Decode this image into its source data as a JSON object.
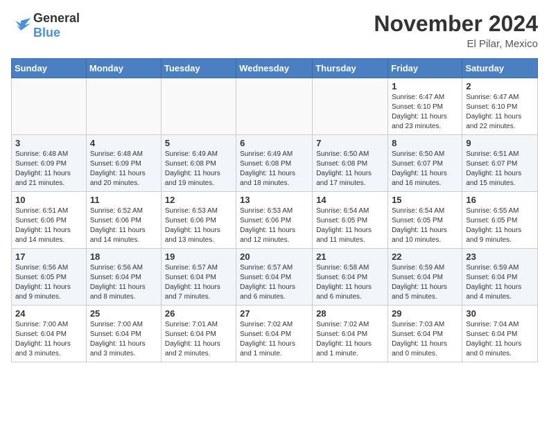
{
  "logo": {
    "general": "General",
    "blue": "Blue"
  },
  "title": "November 2024",
  "location": "El Pilar, Mexico",
  "days_of_week": [
    "Sunday",
    "Monday",
    "Tuesday",
    "Wednesday",
    "Thursday",
    "Friday",
    "Saturday"
  ],
  "weeks": [
    [
      {
        "day": "",
        "info": ""
      },
      {
        "day": "",
        "info": ""
      },
      {
        "day": "",
        "info": ""
      },
      {
        "day": "",
        "info": ""
      },
      {
        "day": "",
        "info": ""
      },
      {
        "day": "1",
        "info": "Sunrise: 6:47 AM\nSunset: 6:10 PM\nDaylight: 11 hours and 23 minutes."
      },
      {
        "day": "2",
        "info": "Sunrise: 6:47 AM\nSunset: 6:10 PM\nDaylight: 11 hours and 22 minutes."
      }
    ],
    [
      {
        "day": "3",
        "info": "Sunrise: 6:48 AM\nSunset: 6:09 PM\nDaylight: 11 hours and 21 minutes."
      },
      {
        "day": "4",
        "info": "Sunrise: 6:48 AM\nSunset: 6:09 PM\nDaylight: 11 hours and 20 minutes."
      },
      {
        "day": "5",
        "info": "Sunrise: 6:49 AM\nSunset: 6:08 PM\nDaylight: 11 hours and 19 minutes."
      },
      {
        "day": "6",
        "info": "Sunrise: 6:49 AM\nSunset: 6:08 PM\nDaylight: 11 hours and 18 minutes."
      },
      {
        "day": "7",
        "info": "Sunrise: 6:50 AM\nSunset: 6:08 PM\nDaylight: 11 hours and 17 minutes."
      },
      {
        "day": "8",
        "info": "Sunrise: 6:50 AM\nSunset: 6:07 PM\nDaylight: 11 hours and 16 minutes."
      },
      {
        "day": "9",
        "info": "Sunrise: 6:51 AM\nSunset: 6:07 PM\nDaylight: 11 hours and 15 minutes."
      }
    ],
    [
      {
        "day": "10",
        "info": "Sunrise: 6:51 AM\nSunset: 6:06 PM\nDaylight: 11 hours and 14 minutes."
      },
      {
        "day": "11",
        "info": "Sunrise: 6:52 AM\nSunset: 6:06 PM\nDaylight: 11 hours and 14 minutes."
      },
      {
        "day": "12",
        "info": "Sunrise: 6:53 AM\nSunset: 6:06 PM\nDaylight: 11 hours and 13 minutes."
      },
      {
        "day": "13",
        "info": "Sunrise: 6:53 AM\nSunset: 6:06 PM\nDaylight: 11 hours and 12 minutes."
      },
      {
        "day": "14",
        "info": "Sunrise: 6:54 AM\nSunset: 6:05 PM\nDaylight: 11 hours and 11 minutes."
      },
      {
        "day": "15",
        "info": "Sunrise: 6:54 AM\nSunset: 6:05 PM\nDaylight: 11 hours and 10 minutes."
      },
      {
        "day": "16",
        "info": "Sunrise: 6:55 AM\nSunset: 6:05 PM\nDaylight: 11 hours and 9 minutes."
      }
    ],
    [
      {
        "day": "17",
        "info": "Sunrise: 6:56 AM\nSunset: 6:05 PM\nDaylight: 11 hours and 9 minutes."
      },
      {
        "day": "18",
        "info": "Sunrise: 6:56 AM\nSunset: 6:04 PM\nDaylight: 11 hours and 8 minutes."
      },
      {
        "day": "19",
        "info": "Sunrise: 6:57 AM\nSunset: 6:04 PM\nDaylight: 11 hours and 7 minutes."
      },
      {
        "day": "20",
        "info": "Sunrise: 6:57 AM\nSunset: 6:04 PM\nDaylight: 11 hours and 6 minutes."
      },
      {
        "day": "21",
        "info": "Sunrise: 6:58 AM\nSunset: 6:04 PM\nDaylight: 11 hours and 6 minutes."
      },
      {
        "day": "22",
        "info": "Sunrise: 6:59 AM\nSunset: 6:04 PM\nDaylight: 11 hours and 5 minutes."
      },
      {
        "day": "23",
        "info": "Sunrise: 6:59 AM\nSunset: 6:04 PM\nDaylight: 11 hours and 4 minutes."
      }
    ],
    [
      {
        "day": "24",
        "info": "Sunrise: 7:00 AM\nSunset: 6:04 PM\nDaylight: 11 hours and 3 minutes."
      },
      {
        "day": "25",
        "info": "Sunrise: 7:00 AM\nSunset: 6:04 PM\nDaylight: 11 hours and 3 minutes."
      },
      {
        "day": "26",
        "info": "Sunrise: 7:01 AM\nSunset: 6:04 PM\nDaylight: 11 hours and 2 minutes."
      },
      {
        "day": "27",
        "info": "Sunrise: 7:02 AM\nSunset: 6:04 PM\nDaylight: 11 hours and 1 minute."
      },
      {
        "day": "28",
        "info": "Sunrise: 7:02 AM\nSunset: 6:04 PM\nDaylight: 11 hours and 1 minute."
      },
      {
        "day": "29",
        "info": "Sunrise: 7:03 AM\nSunset: 6:04 PM\nDaylight: 11 hours and 0 minutes."
      },
      {
        "day": "30",
        "info": "Sunrise: 7:04 AM\nSunset: 6:04 PM\nDaylight: 11 hours and 0 minutes."
      }
    ]
  ]
}
